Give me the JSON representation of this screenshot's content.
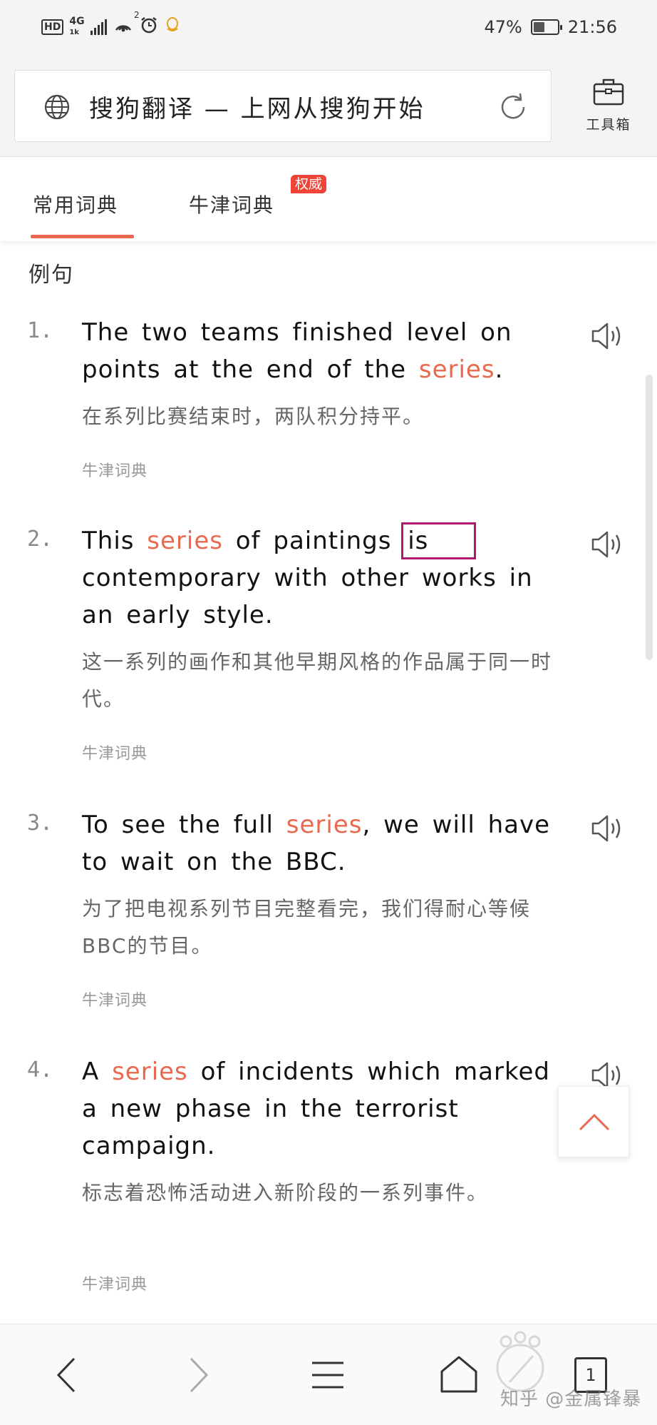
{
  "status_bar": {
    "hd": "HD",
    "network": "4G",
    "network_sub": "1k",
    "hotspot_count": "2",
    "battery_text": "47%",
    "battery_level": 0.47,
    "time": "21:56"
  },
  "header": {
    "url_title": "搜狗翻译 — 上网从搜狗开始",
    "toolbox_label": "工具箱",
    "icons": [
      "globe-icon",
      "reload-icon",
      "toolbox-icon"
    ]
  },
  "tabs": {
    "items": [
      {
        "label": "常用词典",
        "active": true
      },
      {
        "label": "牛津词典",
        "active": false
      }
    ],
    "badge": "权威",
    "accent_color": "#e8694d",
    "badge_color": "#f04438"
  },
  "section": {
    "title": "例句"
  },
  "examples": [
    {
      "num": "1.",
      "en_parts": [
        "The two teams finished level on points at the end of the ",
        "series",
        "."
      ],
      "zh": "在系列比赛结束时，两队积分持平。",
      "source": "牛津词典"
    },
    {
      "num": "2.",
      "en_parts": [
        "This ",
        "series",
        " of paintings ",
        "is",
        " contemporary with other works in an early style."
      ],
      "zh": "这一系列的画作和其他早期风格的作品属于同一时代。",
      "source": "牛津词典"
    },
    {
      "num": "3.",
      "en_parts": [
        "To see the full ",
        "series",
        ", we will have to wait on the BBC."
      ],
      "zh": "为了把电视系列节目完整看完，我们得耐心等候BBC的节目。",
      "source": "牛津词典"
    },
    {
      "num": "4.",
      "en_parts": [
        "A ",
        "series",
        " of incidents which marked a new phase in the terrorist campaign."
      ],
      "zh": "标志着恐怖活动进入新阶段的一系列事件。",
      "source": "牛津词典"
    }
  ],
  "bottom_nav": {
    "icons": [
      "back-icon",
      "forward-icon",
      "menu-icon",
      "home-icon"
    ],
    "tab_count": "1"
  },
  "watermark": "知乎 @金属锋暴"
}
